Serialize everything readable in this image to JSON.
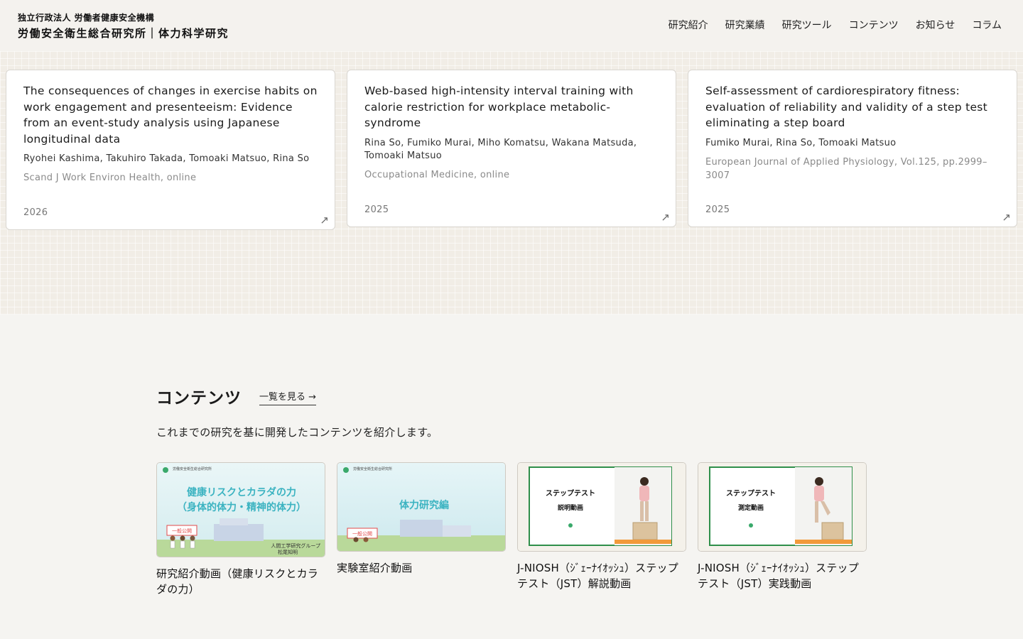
{
  "header": {
    "org_name": "独立行政法人 労働者健康安全機構",
    "inst_name": "労働安全衛生総合研究所｜体力科学研究",
    "nav": [
      {
        "label": "研究紹介"
      },
      {
        "label": "研究業績"
      },
      {
        "label": "研究ツール"
      },
      {
        "label": "コンテンツ"
      },
      {
        "label": "お知らせ"
      },
      {
        "label": "コラム"
      }
    ]
  },
  "publications": [
    {
      "title": "The consequences of changes in exercise habits on work engagement and presenteeism: Evidence from an event-study analysis using Japanese longitudinal data",
      "authors": "Ryohei Kashima, Takuhiro Takada, Tomoaki Matsuo, Rina So",
      "journal": "Scand J Work Environ Health, online",
      "year": "2026",
      "arrow": "↗"
    },
    {
      "title": "Web-based high-intensity interval training with calorie restriction for workplace metabolic-syndrome",
      "authors": "Rina So, Fumiko Murai, Miho Komatsu, Wakana Matsuda, Tomoaki Matsuo",
      "journal": "Occupational Medicine, online",
      "year": "2025",
      "arrow": "↗"
    },
    {
      "title": "Self-assessment of cardiorespiratory fitness: evaluation of reliability and validity of a step test eliminating a step board",
      "authors": "Fumiko Murai, Rina So, Tomoaki Matsuo",
      "journal": "European Journal of Applied Physiology, Vol.125, pp.2999–3007",
      "year": "2025",
      "arrow": "↗"
    }
  ],
  "contents": {
    "title": "コンテンツ",
    "view_all": "一覧を見る →",
    "description": "これまでの研究を基に開発したコンテンツを紹介します。",
    "items": [
      {
        "label": "研究紹介動画（健康リスクとカラダの力）",
        "thumb_header": "労働安全衛生総合研究所",
        "thumb_line1": "健康リスクとカラダの力",
        "thumb_line2": "（身体的体力・精神的体力）",
        "thumb_sign": "一般公開",
        "thumb_footer1": "人間工学研究グループ",
        "thumb_footer2": "松尾知明"
      },
      {
        "label": "実験室紹介動画",
        "thumb_header": "労働安全衛生総合研究所",
        "thumb_line1": "体力研究編",
        "thumb_sign": "一般公開"
      },
      {
        "label": "J-NIOSH（ｼﾞｪｰﾅｲｵｯｼｭ）ステップテスト（JST）解説動画",
        "thumb_line1": "ステップテスト",
        "thumb_line2": "説明動画"
      },
      {
        "label": "J-NIOSH（ｼﾞｪｰﾅｲｵｯｼｭ）ステップテスト（JST）実践動画",
        "thumb_line1": "ステップテスト",
        "thumb_line2": "測定動画"
      }
    ]
  }
}
